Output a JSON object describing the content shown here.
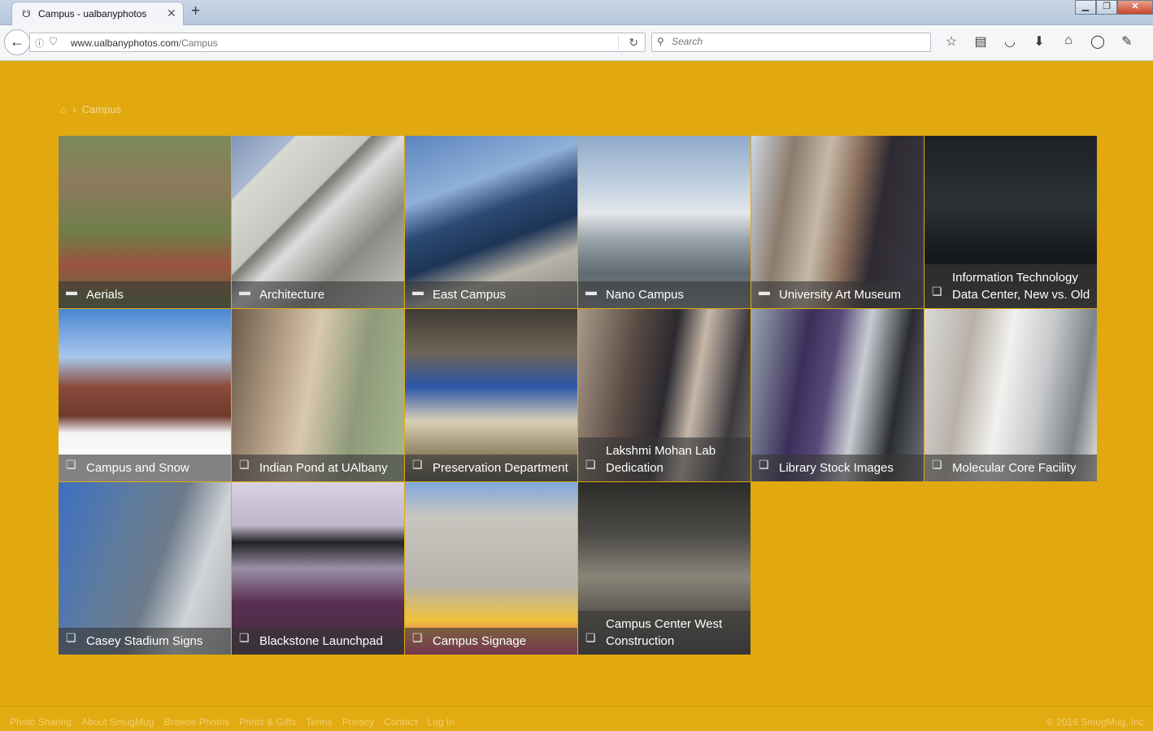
{
  "browser": {
    "tab_title": "Campus - ualbanyphotos",
    "tab_close": "✕",
    "new_tab": "+",
    "url_domain": "www.ualbanyphotos.com",
    "url_path": "/Campus",
    "search_placeholder": "Search",
    "window_buttons": {
      "minimize": "▁",
      "restore": "❐",
      "close": "✕"
    }
  },
  "breadcrumb": {
    "current": "Campus"
  },
  "folder_icon": "folder-icon",
  "gallery_icon": "gallery-icon",
  "tiles": [
    {
      "label": "Aerials",
      "icon": "folder-icon"
    },
    {
      "label": "Architecture",
      "icon": "folder-icon"
    },
    {
      "label": "East Campus",
      "icon": "folder-icon"
    },
    {
      "label": "Nano Campus",
      "icon": "folder-icon"
    },
    {
      "label": "University Art Museum",
      "icon": "folder-icon"
    },
    {
      "label": "Information Technology Data Center, New vs. Old",
      "icon": "gallery-icon"
    },
    {
      "label": "Campus and Snow",
      "icon": "gallery-icon"
    },
    {
      "label": "Indian Pond at UAlbany",
      "icon": "gallery-icon"
    },
    {
      "label": "Preservation Department",
      "icon": "gallery-icon"
    },
    {
      "label": "Lakshmi Mohan Lab Dedication",
      "icon": "gallery-icon"
    },
    {
      "label": "Library Stock Images",
      "icon": "gallery-icon"
    },
    {
      "label": "Molecular Core Facility",
      "icon": "gallery-icon"
    },
    {
      "label": "Casey Stadium Signs",
      "icon": "gallery-icon"
    },
    {
      "label": "Blackstone Launchpad",
      "icon": "gallery-icon"
    },
    {
      "label": "Campus Signage",
      "icon": "gallery-icon"
    },
    {
      "label": "Campus Center West Construction",
      "icon": "gallery-icon"
    }
  ],
  "footer": {
    "links": [
      "Photo Sharing",
      "About SmugMug",
      "Browse Photos",
      "Prints & Gifts",
      "Terms",
      "Privacy",
      "Contact",
      "Log In"
    ],
    "copyright": "© 2016 SmugMug, Inc."
  }
}
